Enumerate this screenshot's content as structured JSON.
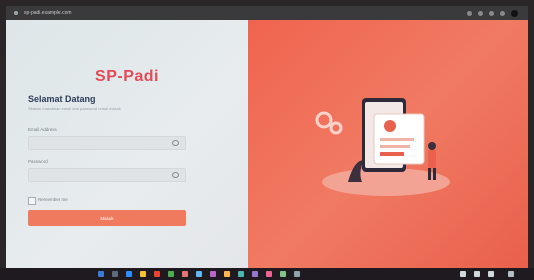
{
  "browser": {
    "tab_title": "sp-padi.example.com"
  },
  "login": {
    "brand": "SP-Padi",
    "welcome": "Selamat Datang",
    "subtitle": "Silakan masukkan email dan password untuk masuk",
    "email_label": "Email Address",
    "email_value": "",
    "password_label": "Password",
    "password_value": "",
    "remember_label": "Remember me",
    "login_button": "Masuk"
  },
  "colors": {
    "brand": "#e34a55",
    "accent": "#ef7a5e",
    "panel": "#f0644f"
  },
  "icons": [
    "eye-icon",
    "eye-icon",
    "checkbox-icon",
    "illustration"
  ]
}
